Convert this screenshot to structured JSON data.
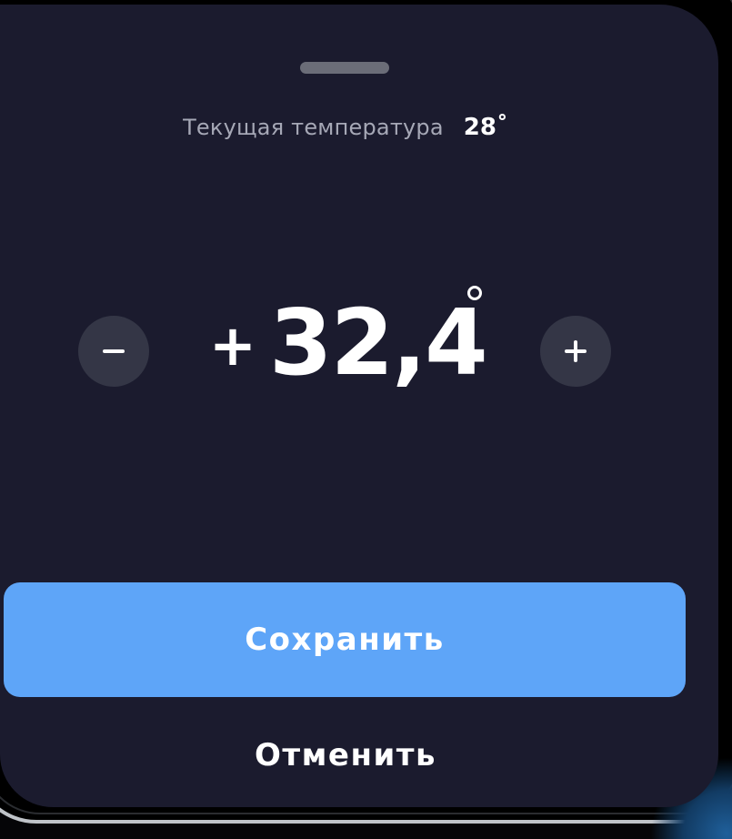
{
  "temperature_sheet": {
    "current_label": "Текущая температура",
    "current_value": "28˚",
    "target_sign": "+",
    "target_value": "32,4",
    "decrease_icon": "minus-icon",
    "increase_icon": "plus-icon",
    "degree_icon": "degree-icon"
  },
  "actions": {
    "save_label": "Сохранить",
    "cancel_label": "Отменить"
  },
  "colors": {
    "sheet_background": "#1b1b2e",
    "stepper_background": "#343646",
    "primary_button": "#5ea5f8",
    "secondary_text": "#a6a8b6",
    "handle": "#6b6d78"
  }
}
